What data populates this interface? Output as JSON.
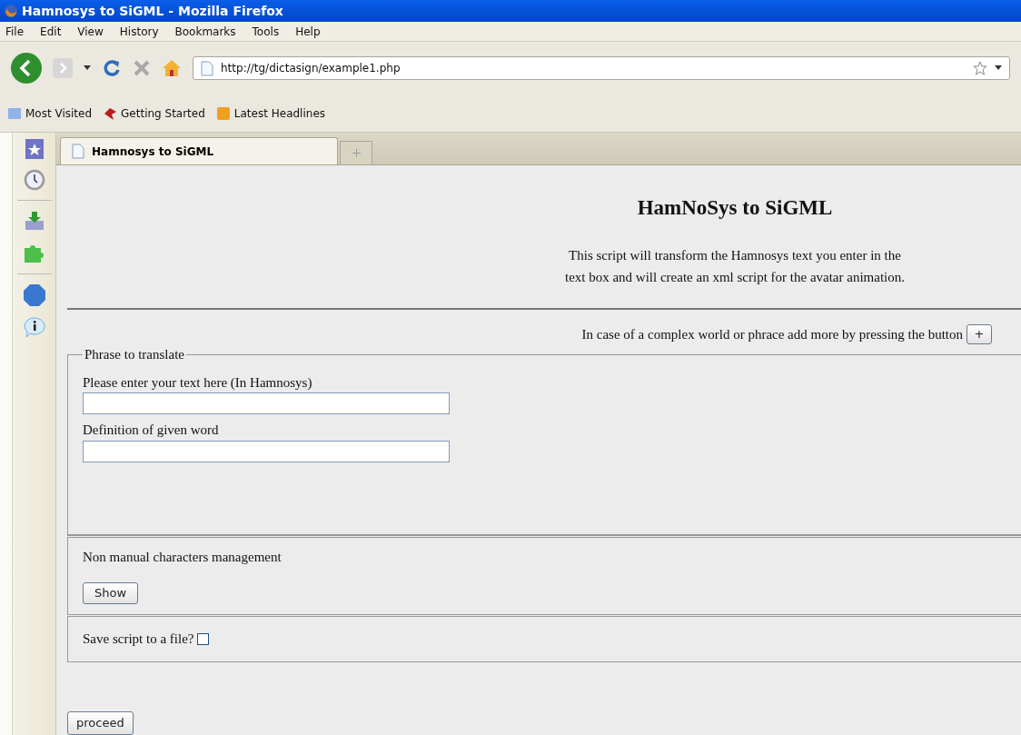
{
  "window": {
    "title": "Hamnosys to SiGML - Mozilla Firefox"
  },
  "menu": [
    "File",
    "Edit",
    "View",
    "History",
    "Bookmarks",
    "Tools",
    "Help"
  ],
  "address_bar": {
    "value": "http://tg/dictasign/example1.php"
  },
  "bookmarks": [
    "Most Visited",
    "Getting Started",
    "Latest Headlines"
  ],
  "tabs": [
    {
      "label": "Hamnosys to SiGML",
      "selected": true
    }
  ],
  "page": {
    "heading": "HamNoSys to SiGML",
    "description": [
      "This script will transform the Hamnosys text you enter in the",
      "text box and will create an xml script for the avatar animation."
    ],
    "add_hint": "In case of a complex world or phrace add more by pressing the button",
    "add_button": "+",
    "phrase_fieldset": {
      "legend": "Phrase to translate",
      "fields": [
        {
          "label": "Please enter your text here (In Hamnosys)"
        },
        {
          "label": "Definition of given word"
        }
      ]
    },
    "non_manual": {
      "label": "Non manual characters management",
      "button": "Show"
    },
    "save": {
      "label": "Save script to a file?",
      "checked": false
    },
    "proceed_button": "proceed"
  }
}
